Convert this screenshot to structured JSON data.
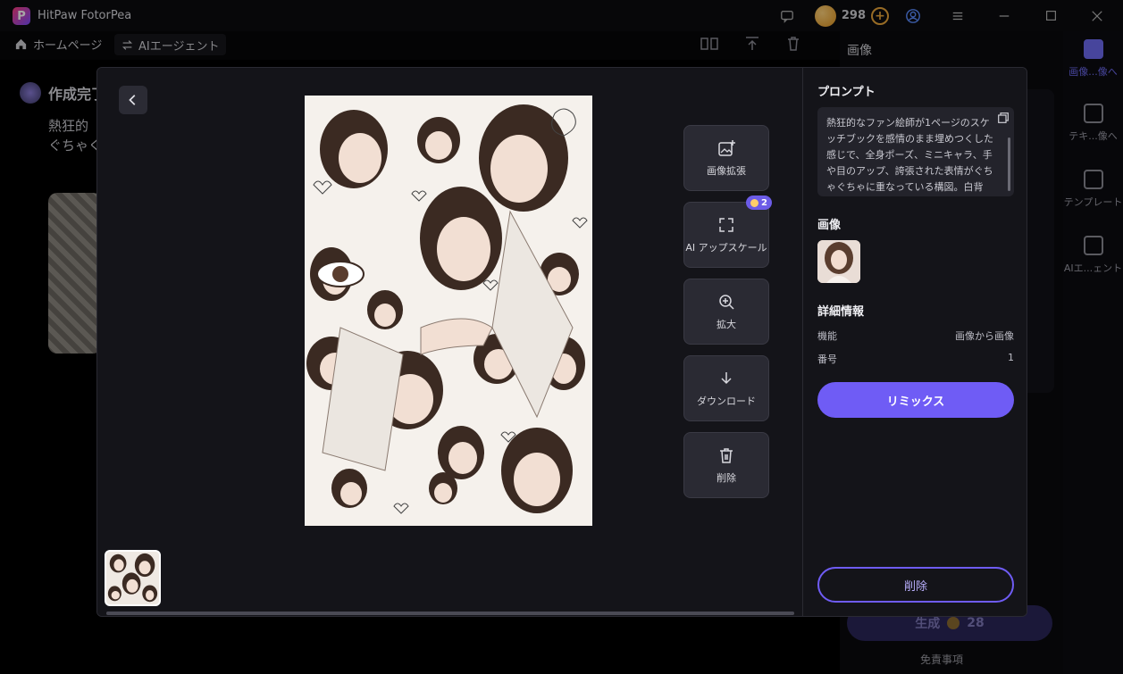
{
  "app": {
    "title": "HitPaw FotorPea",
    "logo_letter": "P",
    "credits": "298"
  },
  "nav": {
    "home": "ホームページ",
    "agent": "AIエージェント"
  },
  "background": {
    "page_title": "作成完了",
    "text_line1": "熱狂的",
    "text_line2": "ぐちゃぐち",
    "panel_heading": "画像",
    "generate_label": "生成",
    "generate_cost": "28",
    "disclaimer": "免責事項"
  },
  "sidebar": {
    "items": [
      {
        "label": "画像...像へ"
      },
      {
        "label": "テキ...像へ"
      },
      {
        "label": "テンプレート"
      },
      {
        "label": "AIエ...ェント"
      }
    ]
  },
  "viewer": {
    "tools": [
      {
        "label": "画像拡張"
      },
      {
        "label": "AI アップスケール",
        "badge": "2"
      },
      {
        "label": "拡大"
      },
      {
        "label": "ダウンロード"
      },
      {
        "label": "削除"
      }
    ]
  },
  "info": {
    "prompt_title": "プロンプト",
    "prompt_text": "熱狂的なファン絵師が1ページのスケッチブックを感情のまま埋めつくした感じで、全身ポーズ、ミニキャラ、手や目のアップ、誇張された表情がぐちゃぐちゃに重なっている構図。白背景。整列なし、余白なし、カオスな落書きエネルギー",
    "image_title": "画像",
    "details_title": "詳細情報",
    "details": [
      {
        "key": "機能",
        "value": "画像から画像"
      },
      {
        "key": "番号",
        "value": "1"
      }
    ],
    "remix_label": "リミックス",
    "delete_label": "削除"
  },
  "colors": {
    "accent": "#6f5cf5",
    "modal_bg": "#141419",
    "tool_bg": "#2a2a33"
  }
}
